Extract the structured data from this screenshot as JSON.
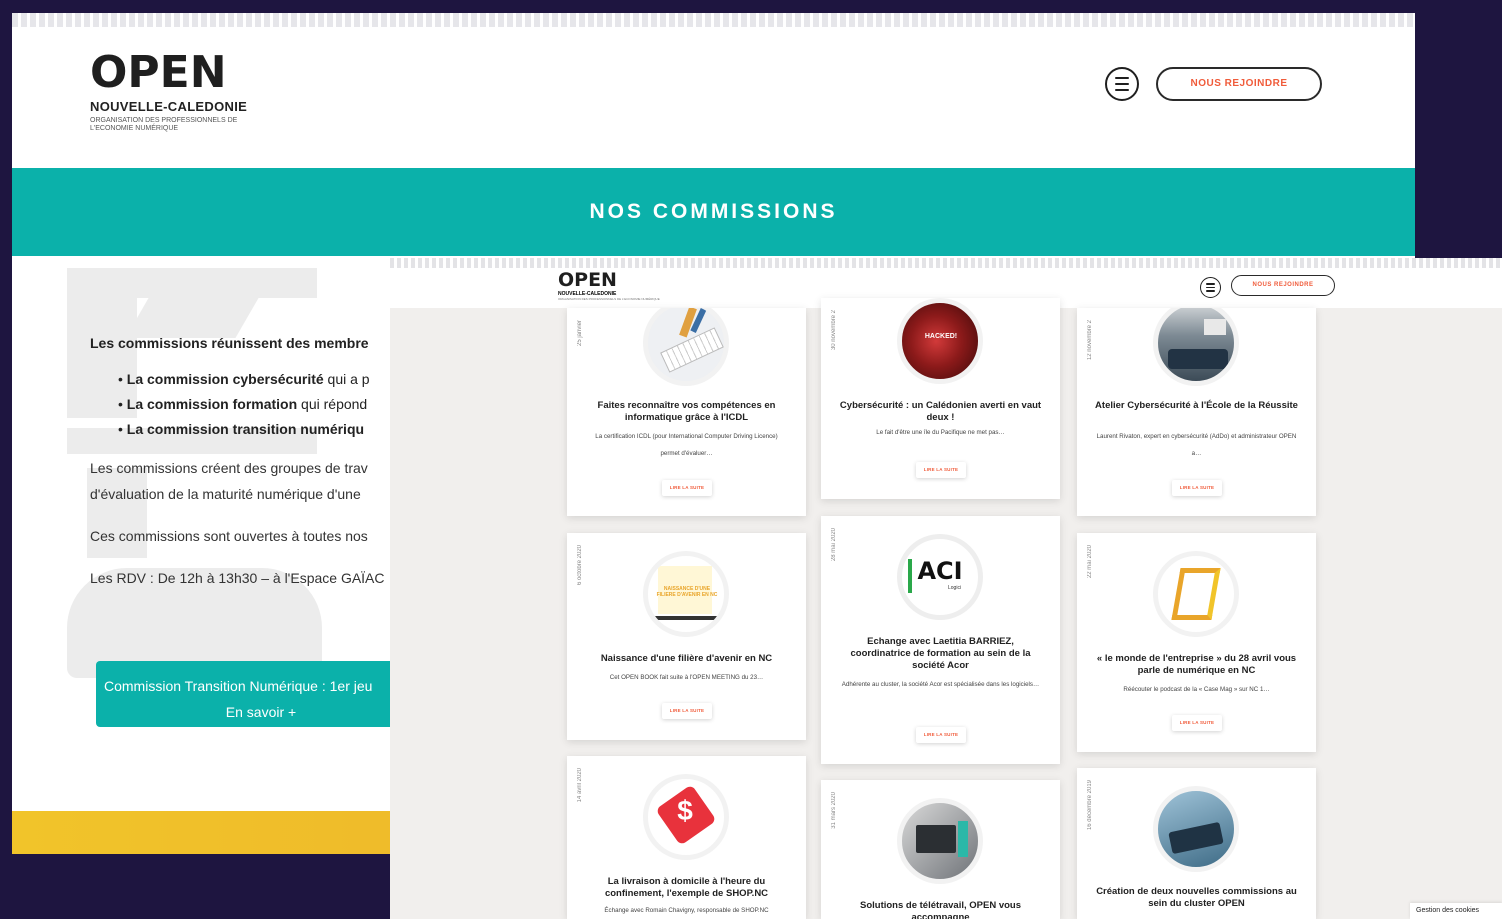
{
  "back": {
    "logo": {
      "word": "OPEN",
      "region": "NOUVELLE-CALEDONIE",
      "tagline": "ORGANISATION DES PROFESSIONNELS DE L'ECONOMIE NUMÉRIQUE"
    },
    "join_label": "NOUS REJOINDRE",
    "band_title": "NOS COMMISSIONS",
    "intro": "Les commissions réunissent des membre",
    "items": [
      {
        "bold": "La commission cybersécurité",
        "rest": " qui a p"
      },
      {
        "bold": "La commission formation",
        "rest": " qui répond"
      },
      {
        "bold": "La commission transition numériqu",
        "rest": ""
      }
    ],
    "para1_line1": "Les commissions créent des groupes de trav",
    "para1_line2": "d'évaluation de la maturité numérique d'une",
    "para2": "Ces commissions sont ouvertes à toutes nos",
    "para3": "Les RDV : De 12h à 13h30 – à l'Espace GAÏAC",
    "cta_title": "Commission Transition Numérique : 1er jeu",
    "cta_more": "En savoir +"
  },
  "front": {
    "logo": {
      "word": "OPEN",
      "region": "NOUVELLE-CALEDONIE",
      "tagline": "ORGANISATION DES PROFESSIONNELS DE L'ECONOMIE NUMÉRIQUE"
    },
    "join_label": "NOUS REJOINDRE",
    "read_more": "LIRE LA SUITE",
    "cookies": "Gestion des cookies",
    "cards": [
      {
        "date": "25 janvier",
        "title": "Faites reconnaître vos compétences en informatique grâce à l'ICDL",
        "excerpt": "La certification ICDL (pour International Computer Driving Licence) permet d'évaluer…"
      },
      {
        "date": "30 novembre 2",
        "title": "Cybersécurité : un Calédonien averti en vaut deux !",
        "excerpt": "Le fait d'être une île du Pacifique ne met pas…",
        "thumb_text": "HACKED!"
      },
      {
        "date": "12 novembre 2",
        "title": "Atelier Cybersécurité à l'École de la Réussite",
        "excerpt": "Laurent Rivaton, expert en cybersécurité (AdDo) et administrateur OPEN a…"
      },
      {
        "date": "6 octobre 2020",
        "title": "Naissance d'une filière d'avenir en NC",
        "excerpt": "Cet OPEN BOOK fait suite à l'OPEN MEETING du 23…",
        "thumb_text": "NAISSANCE D'UNE FILIERE D'AVENIR EN NC"
      },
      {
        "date": "28 mai 2020",
        "title": "Echange avec Laetitia BARRIEZ, coordinatrice de formation au sein de la société Acor",
        "excerpt": "Adhérente au cluster, la société Acor est spécialisée dans les logiciels…",
        "thumb_text": "ACI",
        "thumb_sub": "Logici"
      },
      {
        "date": "22 mai 2020",
        "title": "« le monde de l'entreprise » du 28 avril vous parle de numérique en NC",
        "excerpt": "Réécouter le podcast de la « Case Mag » sur NC 1…"
      },
      {
        "date": "14 avril 2020",
        "title": "La livraison à domicile à l'heure du confinement, l'exemple de SHOP.NC",
        "excerpt": "Échange avec Romain Chavigny, responsable de SHOP.NC"
      },
      {
        "date": "31 mars 2020",
        "title": "Solutions de télétravail, OPEN vous accompagne",
        "excerpt": ""
      },
      {
        "date": "16 décembre 2019",
        "title": "Création de deux nouvelles commissions au sein du cluster OPEN",
        "excerpt": ""
      }
    ]
  }
}
